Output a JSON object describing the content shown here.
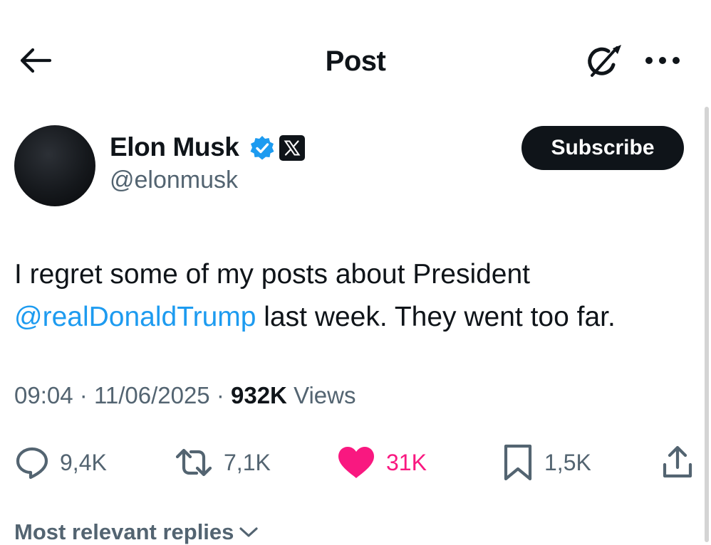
{
  "header": {
    "title": "Post",
    "back_icon": "arrow-left-icon",
    "grok_icon": "grok-icon",
    "more_icon": "more-dots-icon"
  },
  "author": {
    "name": "Elon Musk",
    "handle": "@elonmusk",
    "verified_icon": "verified-badge-icon",
    "affiliate_icon": "x-logo-icon",
    "subscribe_label": "Subscribe"
  },
  "post": {
    "text_before": "I regret some of my posts about President ",
    "mention": "@realDonaldTrump",
    "text_after": " last week. They went too far.",
    "time": "09:04",
    "separator": "·",
    "date": "11/06/2025",
    "views_count": "932K",
    "views_label": "Views"
  },
  "actions": {
    "replies": "9,4K",
    "reposts": "7,1K",
    "likes": "31K",
    "bookmarks": "1,5K"
  },
  "replies": {
    "sort_label": "Most relevant replies"
  },
  "colors": {
    "text": "#0f1419",
    "secondary": "#536471",
    "link": "#1d9bf0",
    "like": "#f91880",
    "verified": "#1d9bf0",
    "button_bg": "#0f1419"
  }
}
